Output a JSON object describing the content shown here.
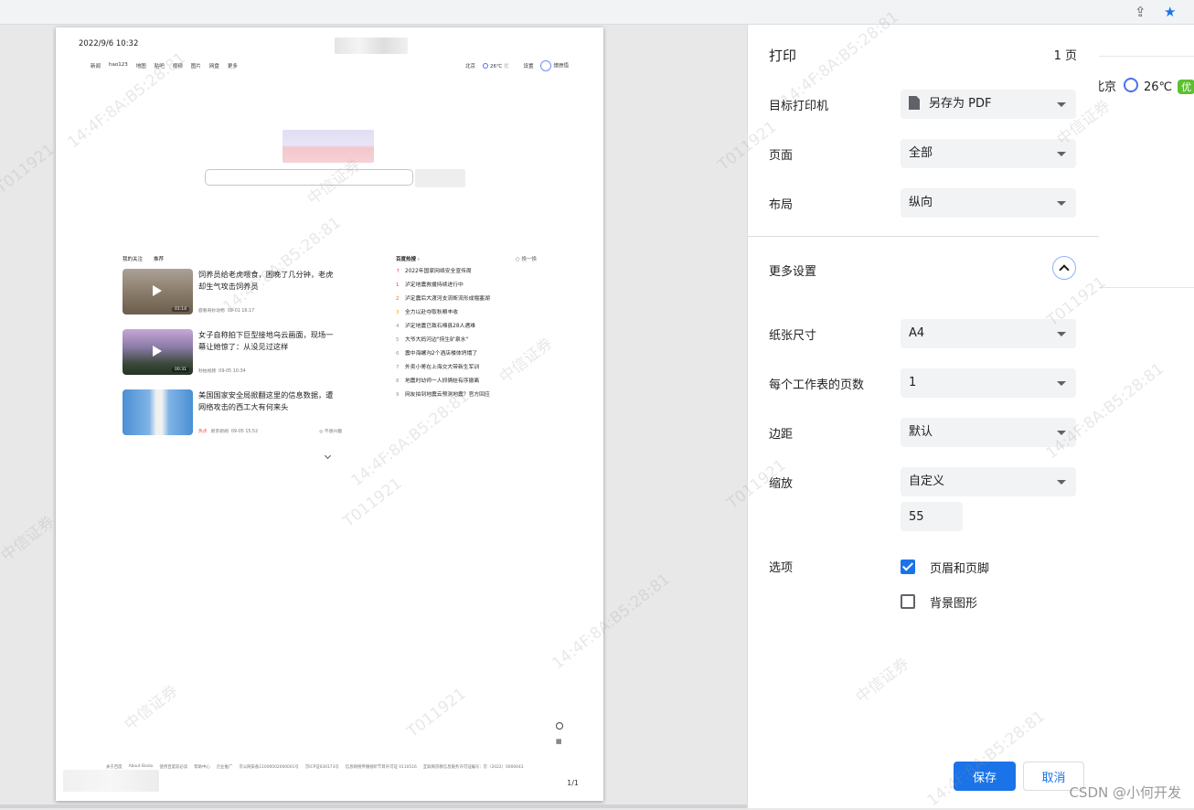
{
  "toolbar": {
    "share_icon": "share-icon",
    "star_icon": "bookmark-star-icon"
  },
  "background_page": {
    "city": "北京",
    "temperature": "26℃",
    "air_quality": "优"
  },
  "preview": {
    "datetime": "2022/9/6 10:32",
    "nav": [
      "新闻",
      "hao123",
      "地图",
      "贴吧",
      "视频",
      "图片",
      "网盘",
      "更多"
    ],
    "top_right": {
      "city": "北京",
      "temperature": "26℃",
      "air_quality": "优",
      "settings": "设置",
      "user": "燎原悟"
    },
    "feed_tabs": [
      "我的关注",
      "推荐"
    ],
    "feed": [
      {
        "title": "饲养员给老虎喂食，困晚了几分钟，老虎却生气攻击饲养员",
        "source": "鹿看奇妙动物",
        "time": "09-01 16:17",
        "duration": "01:14"
      },
      {
        "title": "女子自称拍下巨型接地乌云画面，现场一幕让她惊了：从没见过这样",
        "source": "秒拍视频",
        "time": "09-05 10:34",
        "duration": "00:31"
      },
      {
        "title": "美国国家安全局掀翻这里的信息数据，遭网络攻击的西工大有何来头",
        "tag": "热点",
        "source": "新京新闻",
        "time": "09-05 15:52",
        "dislike": "不感兴趣"
      }
    ],
    "hot": {
      "title": "百度热搜",
      "refresh": "换一换",
      "items": [
        {
          "rank": "",
          "text": "2022年国家网络安全宣传周"
        },
        {
          "rank": "1",
          "text": "泸定地震救援持续进行中"
        },
        {
          "rank": "2",
          "text": "泸定震后大渡河支流断流形成堰塞湖"
        },
        {
          "rank": "3",
          "text": "全力以赴夺取秋粮丰收"
        },
        {
          "rank": "4",
          "text": "泸定地震已致石棉县28人遇难"
        },
        {
          "rank": "5",
          "text": "大爷大妈河边\"捞生矿泉水\""
        },
        {
          "rank": "6",
          "text": "震中海螺沟2个酒店楼体坍塌了"
        },
        {
          "rank": "7",
          "text": "外卖小哥在上海交大带新生军训"
        },
        {
          "rank": "8",
          "text": "地震时幼师一人抓俩娃有序撤离"
        },
        {
          "rank": "9",
          "text": "网友拍到地震云预测地震？官方回应"
        }
      ]
    },
    "footer": [
      "关于百度",
      "About Baidu",
      "使用百度前必读",
      "帮助中心",
      "企业推广",
      "京公网安备11000002000001号",
      "京ICP证030173号",
      "信息网络传播视听节目许可证 0110516",
      "互联网宗教信息服务许可证编号：京（2022）0000043"
    ],
    "page_number": "1/1"
  },
  "panel": {
    "title": "打印",
    "page_count": "1 页",
    "destination": {
      "label": "目标打印机",
      "value": "另存为 PDF"
    },
    "pages": {
      "label": "页面",
      "value": "全部"
    },
    "layout": {
      "label": "布局",
      "value": "纵向"
    },
    "more_settings": "更多设置",
    "paper_size": {
      "label": "纸张尺寸",
      "value": "A4"
    },
    "pages_per_sheet": {
      "label": "每个工作表的页数",
      "value": "1"
    },
    "margins": {
      "label": "边距",
      "value": "默认"
    },
    "scale": {
      "label": "缩放",
      "value": "自定义",
      "custom_value": "55"
    },
    "options": {
      "label": "选项",
      "headers_footers": "页眉和页脚",
      "headers_footers_checked": true,
      "background_graphics": "背景图形",
      "background_graphics_checked": false
    },
    "save": "保存",
    "cancel": "取消"
  },
  "watermark": {
    "id": "T011921",
    "mac": "14:4F:8A:B5:28:81",
    "company": "中信证券"
  },
  "credit": "CSDN @小何开发"
}
